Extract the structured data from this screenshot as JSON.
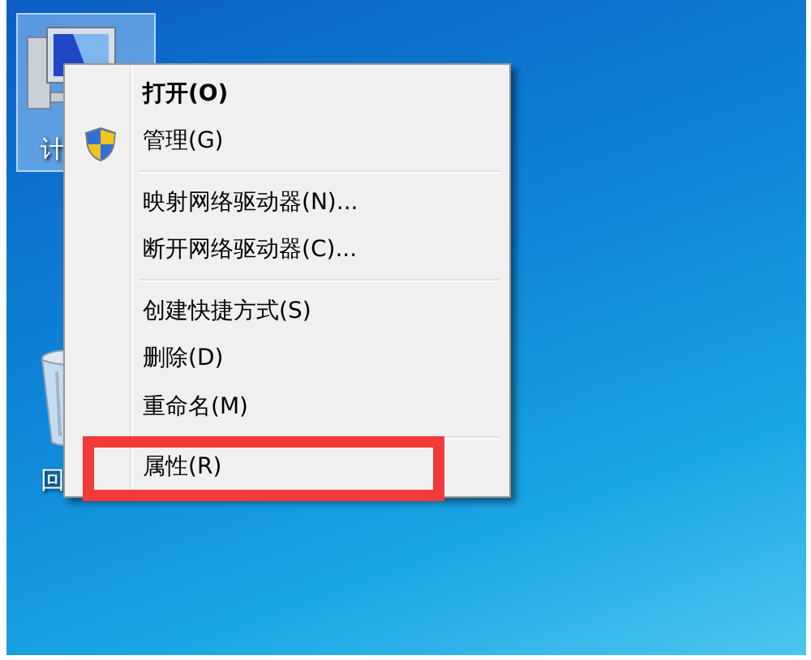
{
  "desktop_icons": [
    {
      "kind": "computer",
      "label": "计",
      "selected": true
    },
    {
      "kind": "recycle-bin",
      "label": "回",
      "selected": false
    }
  ],
  "context_menu": {
    "items": [
      {
        "kind": "item",
        "label": "打开(O)",
        "default": true
      },
      {
        "kind": "shield-item",
        "label": "管理(G)"
      },
      {
        "kind": "separator"
      },
      {
        "kind": "item",
        "label": "映射网络驱动器(N)..."
      },
      {
        "kind": "item",
        "label": "断开网络驱动器(C)..."
      },
      {
        "kind": "separator"
      },
      {
        "kind": "item",
        "label": "创建快捷方式(S)"
      },
      {
        "kind": "item",
        "label": "删除(D)"
      },
      {
        "kind": "item",
        "label": "重命名(M)"
      },
      {
        "kind": "separator"
      },
      {
        "kind": "item",
        "label": "属性(R)",
        "highlighted": true
      }
    ]
  }
}
